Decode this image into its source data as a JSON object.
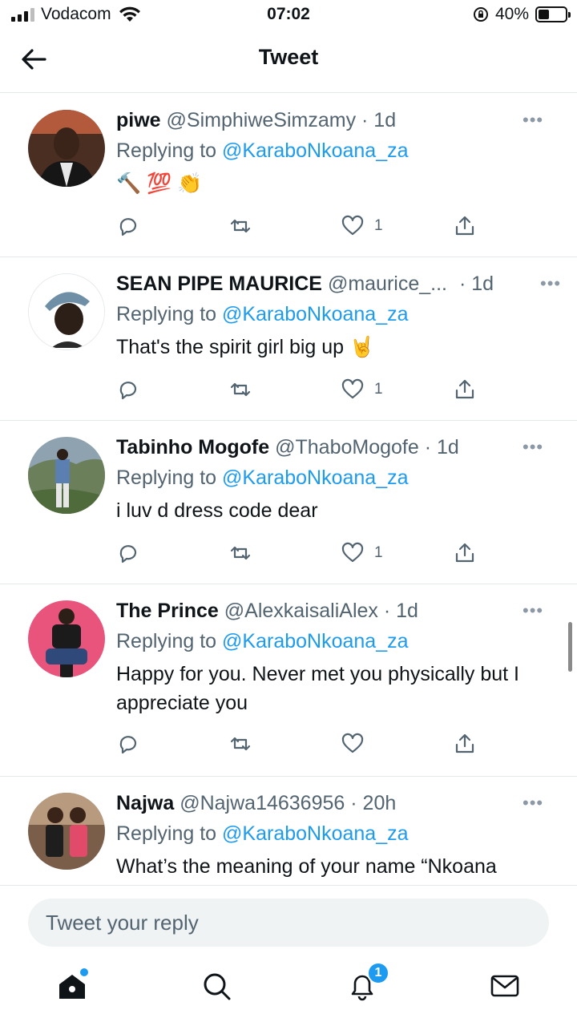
{
  "status_bar": {
    "carrier": "Vodacom",
    "time": "07:02",
    "battery": "40%",
    "battery_level": 0.4
  },
  "header": {
    "title": "Tweet",
    "back_icon": "arrow-left-icon"
  },
  "tweets": [
    {
      "name": "piwe",
      "handle": "@SimphiweSimzamy",
      "time": "· 1d",
      "replying_label": "Replying to",
      "replying_to": "@KaraboNkoana_za",
      "text": "🔨 💯 👏",
      "likes": "1"
    },
    {
      "name": "SEAN PIPE MAURICE",
      "handle": "@maurice_...",
      "time": "· 1d",
      "replying_label": "Replying to",
      "replying_to": "@KaraboNkoana_za",
      "text": "That's the spirit girl big up 🤘",
      "likes": "1"
    },
    {
      "name": "Tabinho Mogofe",
      "handle": "@ThaboMogofe",
      "time": "· 1d",
      "replying_label": "Replying to",
      "replying_to": "@KaraboNkoana_za",
      "text": "i luv d dress code dear",
      "likes": "1"
    },
    {
      "name": "The Prince",
      "handle": "@AlexkaisaliAlex",
      "time": "· 1d",
      "replying_label": "Replying to",
      "replying_to": "@KaraboNkoana_za",
      "text": "Happy for you. Never met you physically but I appreciate you",
      "likes": ""
    },
    {
      "name": "Najwa",
      "handle": "@Najwa14636956",
      "time": "· 20h",
      "replying_label": "Replying to",
      "replying_to": "@KaraboNkoana_za",
      "text": "What’s the meaning of your name “Nkoana",
      "likes": ""
    }
  ],
  "reply_bar": {
    "placeholder": "Tweet your reply"
  },
  "tab_bar": {
    "items": [
      "home-icon",
      "search-icon",
      "notifications-icon",
      "messages-icon"
    ],
    "notification_badge": "1"
  },
  "colors": {
    "accent": "#1d9bf0",
    "text": "#0f1419",
    "muted": "#536471",
    "divider": "#e6e9ec"
  }
}
